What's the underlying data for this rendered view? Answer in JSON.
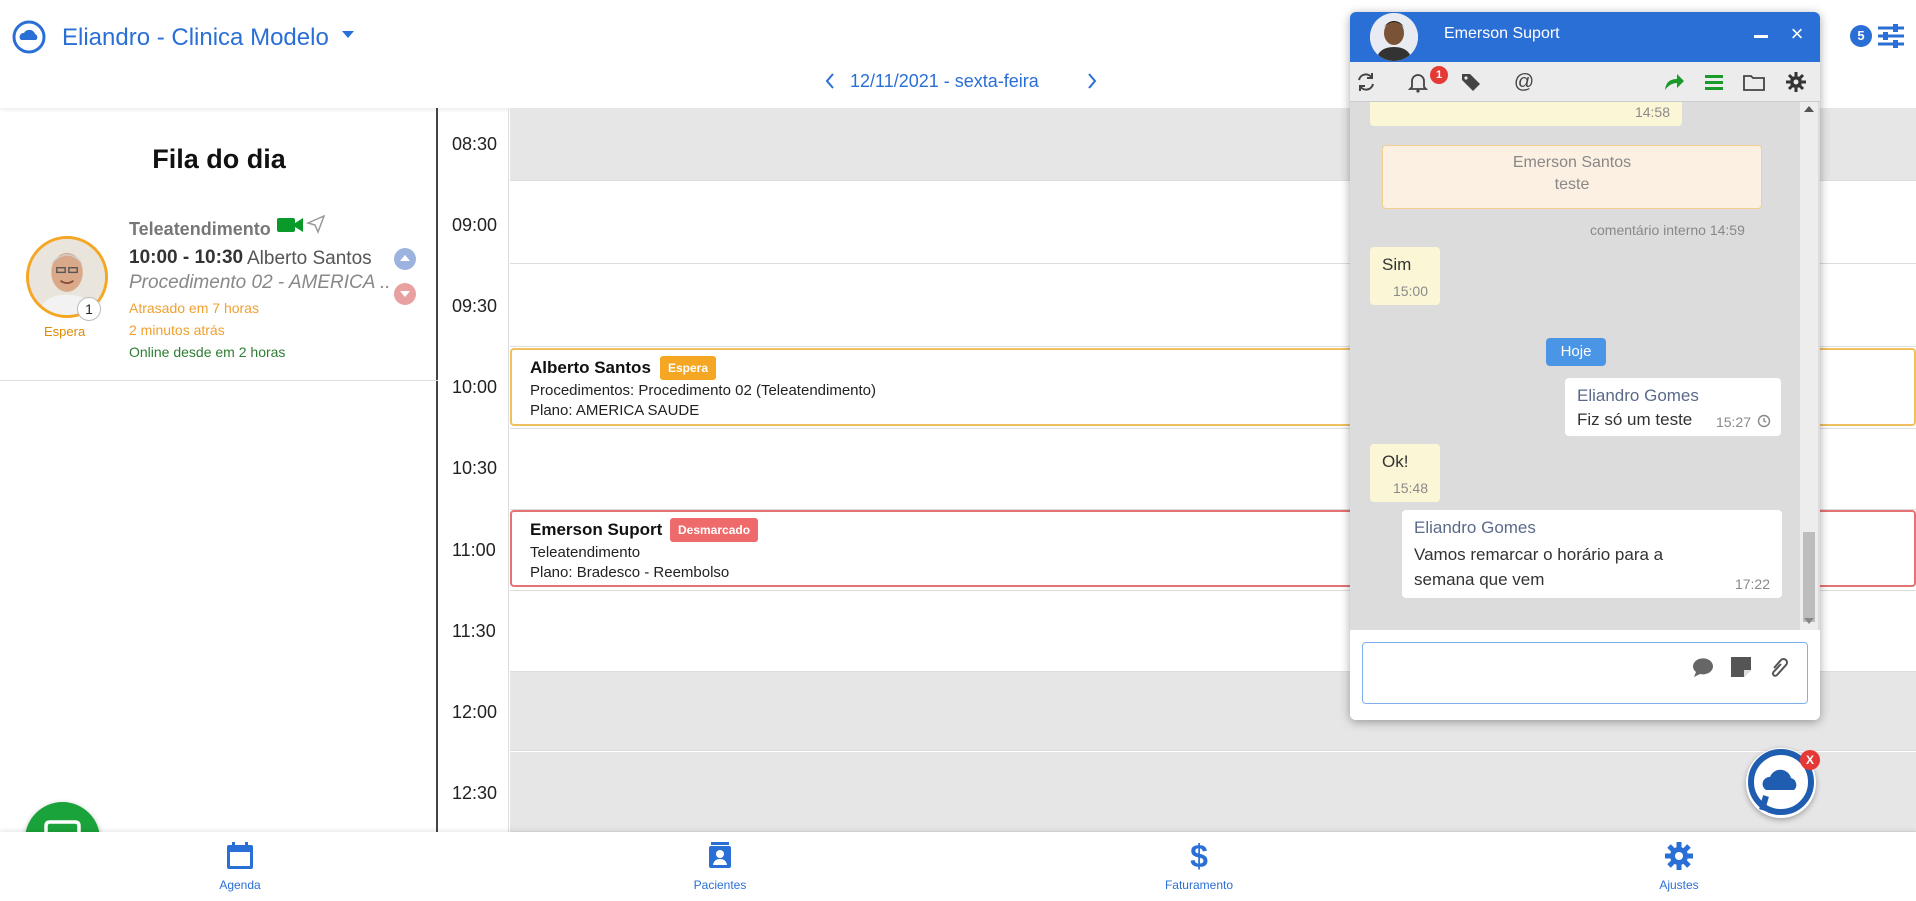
{
  "header": {
    "clinic_name": "Eliandro - Clinica Modelo",
    "date": "12/11/2021 - sexta-feira",
    "notification_count": "5"
  },
  "queue": {
    "title": "Fila do dia",
    "item": {
      "type": "Teleatendimento",
      "time": "10:00 - 10:30",
      "patient": "Alberto Santos",
      "procedure": "Procedimento 02 - AMERICA ...",
      "position": "1",
      "status": "Espera",
      "late": "Atrasado em 7 horas",
      "ago": "2 minutos atrás",
      "online": "Online desde em 2 horas"
    }
  },
  "schedule": {
    "times": [
      "08:30",
      "09:00",
      "09:30",
      "10:00",
      "10:30",
      "11:00",
      "11:30",
      "12:00",
      "12:30"
    ],
    "appointments": [
      {
        "name": "Alberto Santos",
        "badge": "Espera",
        "badge_color": "#f5a623",
        "border_color": "#f0c060",
        "line1": "Procedimentos: Procedimento 02  (Teleatendimento)",
        "line2": "Plano: AMERICA SAUDE"
      },
      {
        "name": "Emerson Suport",
        "badge": "Desmarcado",
        "badge_color": "#ef6b6b",
        "border_color": "#e57373",
        "line1": "Teleatendimento",
        "line2": "Plano: Bradesco - Reembolso"
      }
    ]
  },
  "chat": {
    "title": "Emerson Suport",
    "bell_count": "1",
    "messages": {
      "m0_time": "14:58",
      "internal_author": "Emerson Santos",
      "internal_text": "teste",
      "internal_meta": "comentário interno 14:59",
      "sim_text": "Sim",
      "sim_time": "15:00",
      "today": "Hoje",
      "out1_author": "Eliandro Gomes",
      "out1_text": "Fiz só um teste",
      "out1_time": "15:27",
      "ok_text": "Ok!",
      "ok_time": "15:48",
      "out2_author": "Eliandro Gomes",
      "out2_text": "Vamos remarcar o horário para a semana que vem",
      "out2_time": "17:22"
    },
    "input_value": ""
  },
  "fab": {
    "close": "X"
  },
  "bottom_nav": {
    "items": [
      {
        "label": "Agenda"
      },
      {
        "label": "Pacientes"
      },
      {
        "label": "Faturamento"
      },
      {
        "label": "Ajustes"
      }
    ]
  },
  "colors": {
    "accent": "#2a6fd6",
    "wait": "#f5a623",
    "cancelled": "#ef6b6b",
    "online": "#2e7d32"
  }
}
